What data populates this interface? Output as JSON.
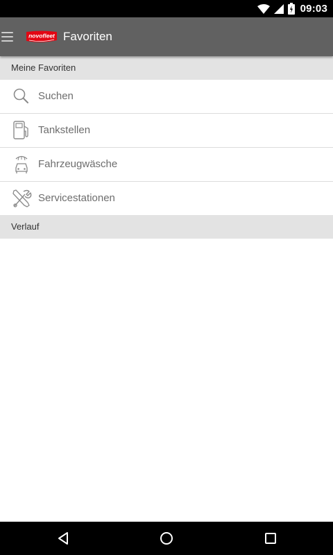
{
  "status_bar": {
    "time": "09:03"
  },
  "app_bar": {
    "logo_text": "novofleet",
    "title": "Favoriten"
  },
  "favorites_section": {
    "header": "Meine Favoriten",
    "items": [
      {
        "label": "Suchen",
        "icon": "search-icon"
      },
      {
        "label": "Tankstellen",
        "icon": "fuel-pump-icon"
      },
      {
        "label": "Fahrzeugwäsche",
        "icon": "car-wash-icon"
      },
      {
        "label": "Servicestationen",
        "icon": "tools-icon"
      }
    ]
  },
  "history_section": {
    "header": "Verlauf"
  },
  "colors": {
    "app_bar": "#616161",
    "section_header": "#e3e3e3",
    "logo_red": "#e30613",
    "label": "#6d6d6d"
  }
}
